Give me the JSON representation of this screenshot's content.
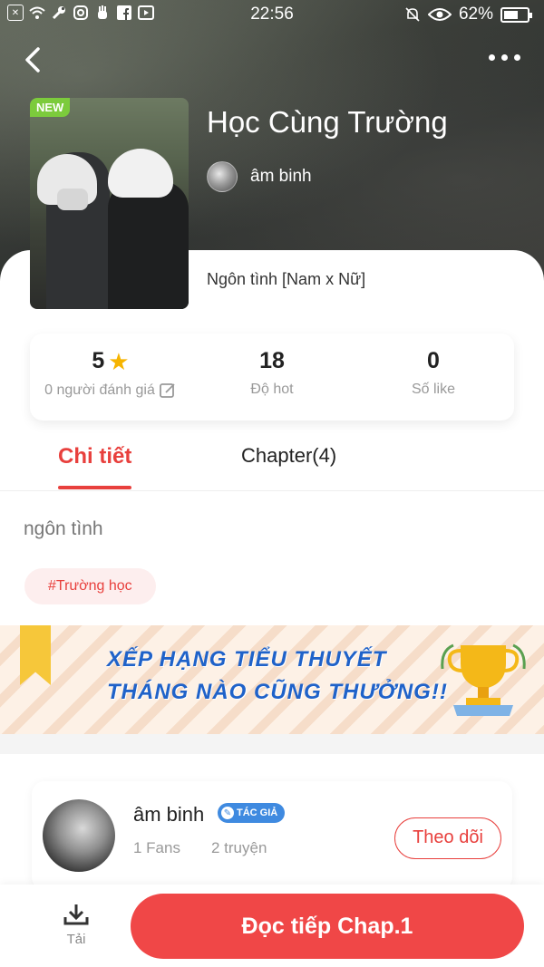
{
  "status_bar": {
    "time": "22:56",
    "battery": "62%",
    "battery_level": 0.62,
    "left_icons": [
      "close-box-icon",
      "wifi-icon",
      "wrench-icon",
      "instagram-icon",
      "hand-icon",
      "facebook-icon",
      "media-icon"
    ],
    "right_icons": [
      "mute-bell-icon",
      "eye-icon",
      "battery-icon"
    ]
  },
  "story": {
    "title": "Học Cùng Trường",
    "author": "âm binh",
    "badge": "NEW",
    "genre": "Ngôn tình [Nam x Nữ]"
  },
  "stats": {
    "rating_value": "5",
    "rating_label": "0 người đánh giá",
    "hot_value": "18",
    "hot_label": "Độ hot",
    "like_value": "0",
    "like_label": "Số like"
  },
  "tabs": {
    "detail": "Chi tiết",
    "chapters": "Chapter(4)"
  },
  "detail": {
    "description": "ngôn tình",
    "tag": "#Trường học"
  },
  "banner": {
    "line1": "XẾP HẠNG TIỂU THUYẾT",
    "line2": "THÁNG NÀO CŨNG THƯỞNG!!"
  },
  "author_card": {
    "name": "âm binh",
    "badge": "TÁC GIẢ",
    "fans": "1 Fans",
    "works": "2 truyện",
    "follow_label": "Theo dõi"
  },
  "bottom_bar": {
    "download_label": "Tải",
    "read_label": "Đọc tiếp Chap.1"
  },
  "colors": {
    "accent": "#e8403d",
    "read_button": "#f04747",
    "new_badge": "#7ccb3c",
    "author_badge": "#3f8ae0",
    "star": "#f6b400",
    "banner_text": "#1f62c9"
  }
}
